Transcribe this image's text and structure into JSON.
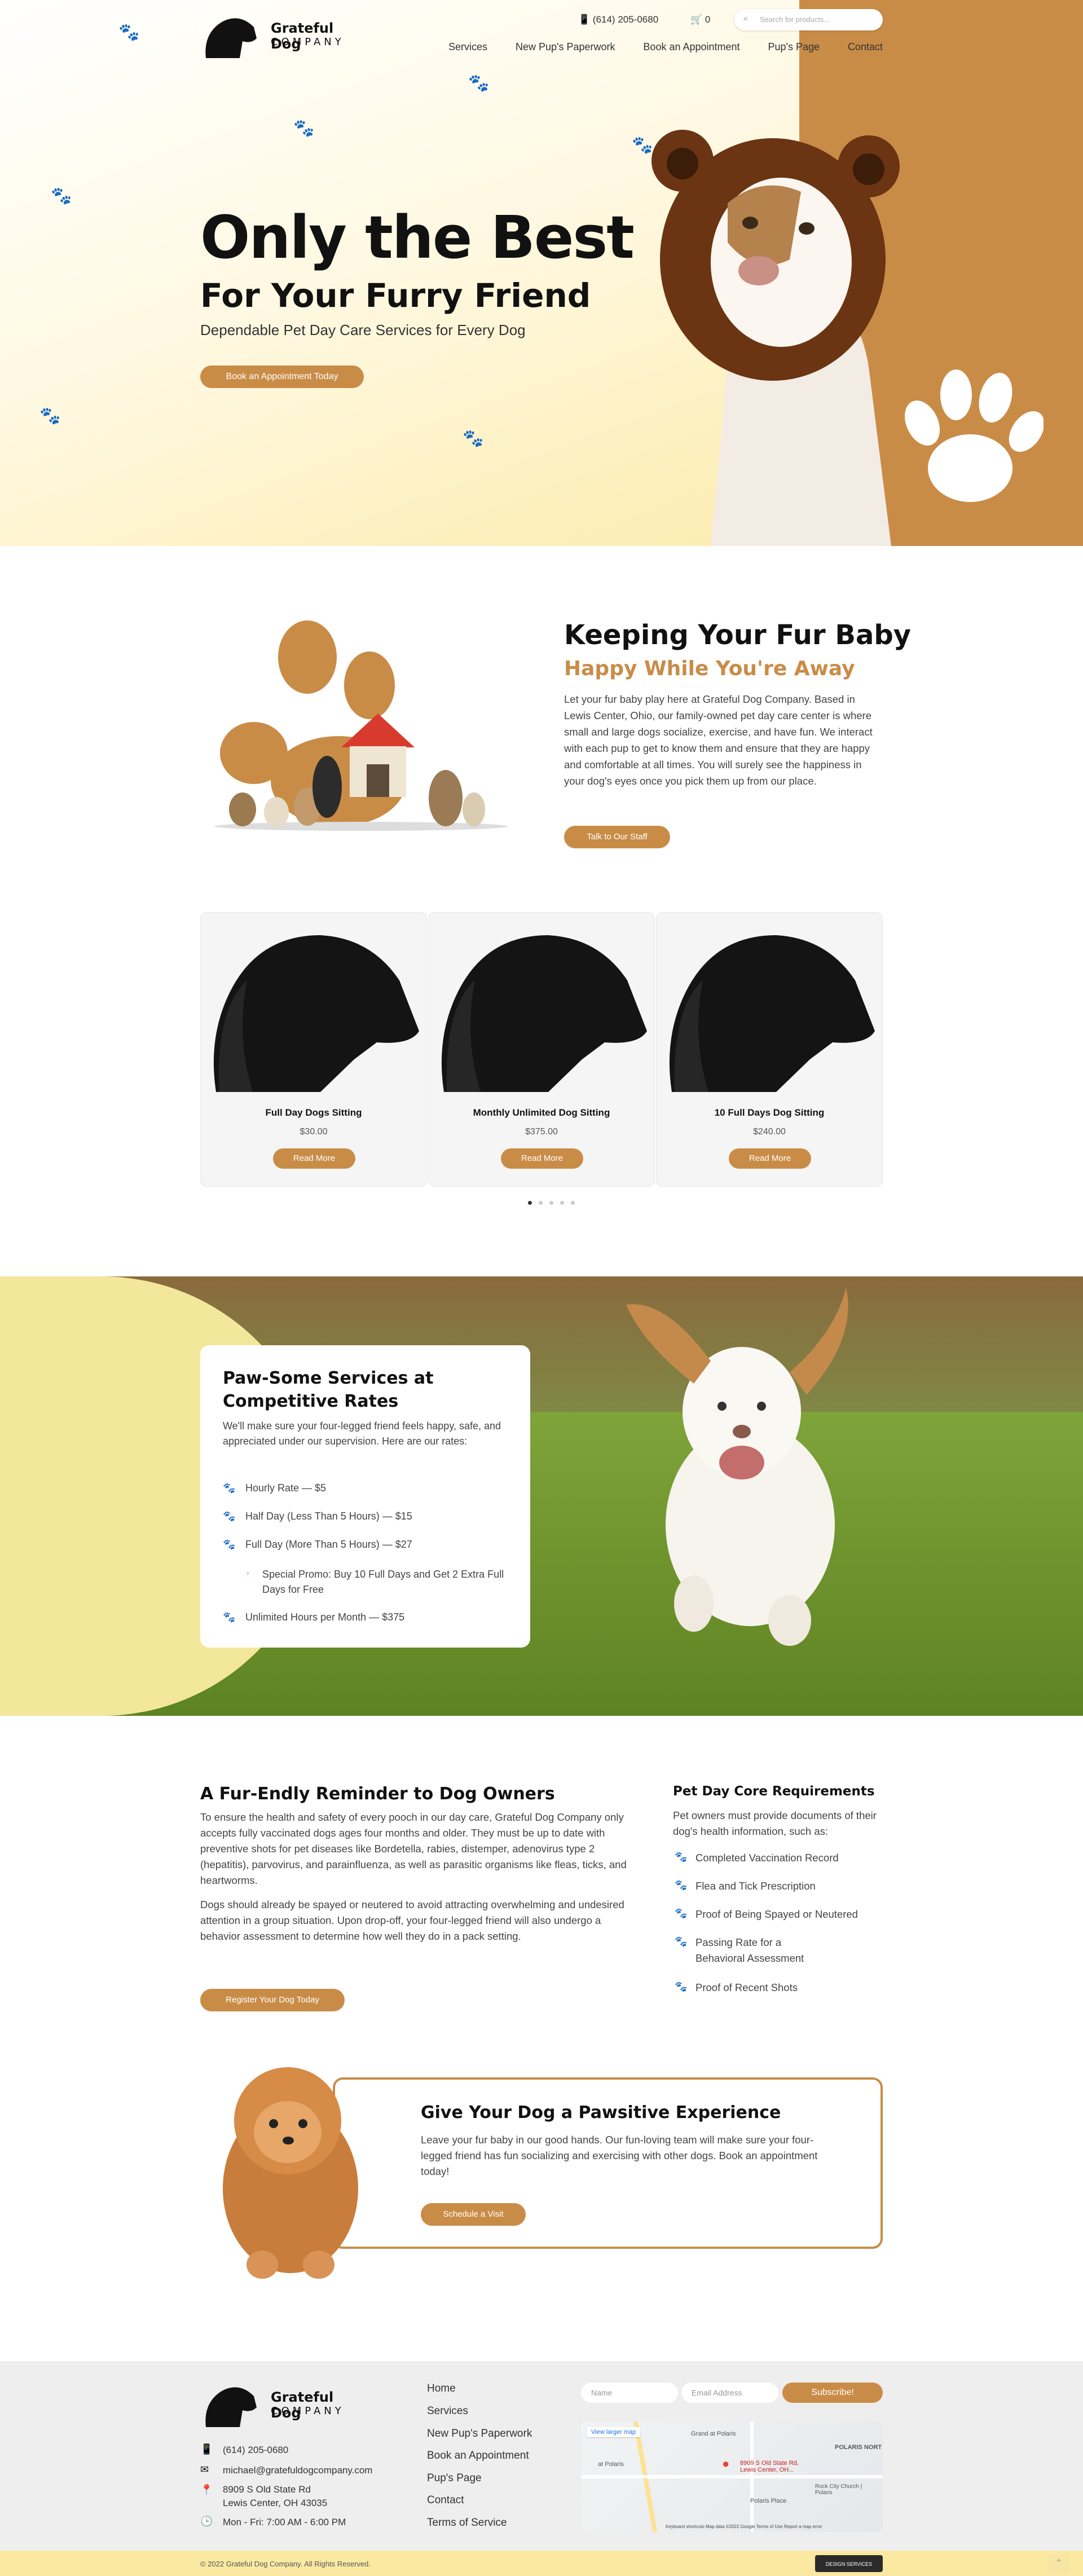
{
  "brand": {
    "name_line1": "Grateful Dog",
    "name_line2": "COMPANY"
  },
  "header": {
    "phone": "(614) 205-0680",
    "cart_count": "0",
    "search_placeholder": "Search for products...",
    "nav": [
      "Services",
      "New Pup's Paperwork",
      "Book an Appointment",
      "Pup's Page",
      "Contact"
    ]
  },
  "hero": {
    "title": "Only the Best",
    "subtitle": "For Your Furry Friend",
    "tagline": "Dependable Pet Day Care Services for Every Dog",
    "button": "Book an Appointment Today"
  },
  "about": {
    "title": "Keeping Your Fur Baby",
    "subtitle": "Happy While You're Away",
    "text": "Let your fur baby play here at Grateful Dog Company. Based in Lewis Center, Ohio, our family-owned pet day care center is where small and large dogs socialize, exercise, and have fun. We interact with each pup to get to know them and ensure that they are happy and comfortable at all times. You will surely see the happiness in your dog's eyes once you pick them up from our place.",
    "button": "Talk to Our Staff"
  },
  "products": [
    {
      "name": "Full Day Dogs Sitting",
      "price": "$30.00",
      "button": "Read More"
    },
    {
      "name": "Monthly Unlimited Dog Sitting",
      "price": "$375.00",
      "button": "Read More"
    },
    {
      "name": "10 Full Days Dog Sitting",
      "price": "$240.00",
      "button": "Read More"
    }
  ],
  "rates": {
    "title": "Paw-Some Services at Competitive Rates",
    "intro": "We'll make sure your four-legged friend feels happy, safe, and appreciated under our supervision. Here are our rates:",
    "items": [
      "Hourly Rate — $5",
      "Half Day (Less Than 5 Hours) — $15",
      "Full Day (More Than 5 Hours) — $27",
      "Special Promo: Buy 10 Full Days and Get 2 Extra Full Days for Free",
      "Unlimited Hours per Month — $375"
    ]
  },
  "reminder": {
    "title": "A Fur-Endly Reminder to Dog Owners",
    "p1": "To ensure the health and safety of every pooch in our day care, Grateful Dog Company only accepts fully vaccinated dogs ages four months and older. They must be up to date with preventive shots for pet diseases like Bordetella, rabies, distemper, adenovirus type 2 (hepatitis), parvovirus, and parainfluenza, as well as parasitic organisms like fleas, ticks, and heartworms.",
    "p2": "Dogs should already be spayed or neutered to avoid attracting overwhelming and undesired attention in a group situation. Upon drop-off, your four-legged friend will also undergo a behavior assessment to determine how well they do in a pack setting.",
    "button": "Register Your Dog Today"
  },
  "requirements": {
    "title": "Pet Day Core Requirements",
    "intro": "Pet owners must provide documents of their dog's health information, such as:",
    "items": [
      "Completed Vaccination Record",
      "Flea and Tick Prescription",
      "Proof of Being Spayed or Neutered",
      "Passing Rate for a Behavioral Assessment",
      "Proof of Recent Shots"
    ]
  },
  "cta": {
    "title": "Give Your Dog a Pawsitive Experience",
    "text": "Leave your fur baby in our good hands. Our fun-loving team will make sure your four-legged friend has fun socializing and exercising with other dogs. Book an appointment today!",
    "button": "Schedule a Visit"
  },
  "footer": {
    "phone": "(614) 205-0680",
    "email": "michael@gratefuldogcompany.com",
    "address_line1": "8909 S Old State Rd",
    "address_line2": "Lewis Center, OH 43035",
    "hours": "Mon - Fri: 7:00 AM - 6:00 PM",
    "links": [
      "Home",
      "Services",
      "New Pup's Paperwork",
      "Book an Appointment",
      "Pup's Page",
      "Contact",
      "Terms of Service"
    ],
    "name_placeholder": "Name",
    "email_placeholder": "Email Address",
    "subscribe": "Subscribe!",
    "map": {
      "view_larger": "View larger map",
      "pin_label": "8909 S Old State Rd, Lewis Center, OH...",
      "place1": "Grand at Polaris",
      "place2": "POLARIS NORT",
      "place3": "Rock City Church | Polaris",
      "place4": "Polaris Place",
      "place5": "at Polaris",
      "credits": "Keyboard shortcuts  Map data ©2022 Google  Terms of Use  Report a map error"
    },
    "copyright": "© 2022 Grateful Dog Company. All Rights Reserved.",
    "badge": "DESIGN SERVICES"
  },
  "colors": {
    "accent": "#c98c47",
    "hero_yellow": "#fbe9a2",
    "footer_bg": "#eeeeee"
  }
}
